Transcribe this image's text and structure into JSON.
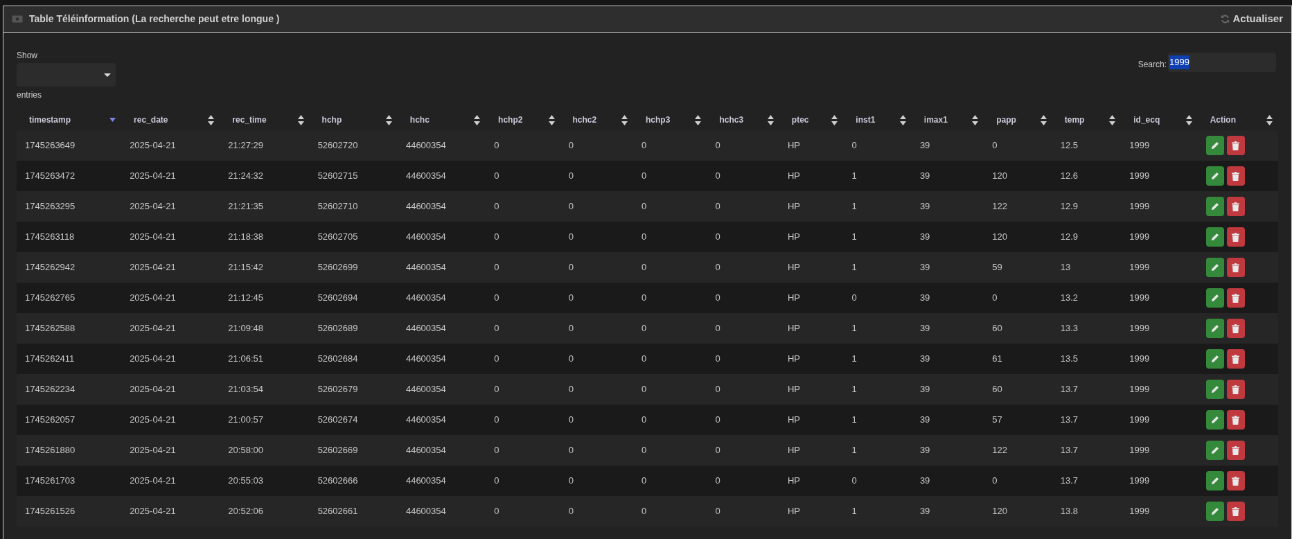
{
  "panel": {
    "title": "Table Téléinformation (La recherche peut etre longue )",
    "refresh_label": "Actualiser"
  },
  "length_control": {
    "label_before": "Show",
    "label_after": "entries"
  },
  "search": {
    "label": "Search:",
    "value": "1999",
    "selected": true
  },
  "table": {
    "columns": [
      {
        "label": "timestamp",
        "sorted": true
      },
      {
        "label": "rec_date",
        "sorted": false
      },
      {
        "label": "rec_time",
        "sorted": false
      },
      {
        "label": "hchp",
        "sorted": false
      },
      {
        "label": "hchc",
        "sorted": false
      },
      {
        "label": "hchp2",
        "sorted": false
      },
      {
        "label": "hchc2",
        "sorted": false
      },
      {
        "label": "hchp3",
        "sorted": false
      },
      {
        "label": "hchc3",
        "sorted": false
      },
      {
        "label": "ptec",
        "sorted": false
      },
      {
        "label": "inst1",
        "sorted": false
      },
      {
        "label": "imax1",
        "sorted": false
      },
      {
        "label": "papp",
        "sorted": false
      },
      {
        "label": "temp",
        "sorted": false
      },
      {
        "label": "id_ecq",
        "sorted": false
      },
      {
        "label": "Action",
        "sorted": false
      }
    ],
    "rows": [
      [
        "1745263649",
        "2025-04-21",
        "21:27:29",
        "52602720",
        "44600354",
        "0",
        "0",
        "0",
        "0",
        "HP",
        "0",
        "39",
        "0",
        "12.5",
        "1999"
      ],
      [
        "1745263472",
        "2025-04-21",
        "21:24:32",
        "52602715",
        "44600354",
        "0",
        "0",
        "0",
        "0",
        "HP",
        "1",
        "39",
        "120",
        "12.6",
        "1999"
      ],
      [
        "1745263295",
        "2025-04-21",
        "21:21:35",
        "52602710",
        "44600354",
        "0",
        "0",
        "0",
        "0",
        "HP",
        "1",
        "39",
        "122",
        "12.9",
        "1999"
      ],
      [
        "1745263118",
        "2025-04-21",
        "21:18:38",
        "52602705",
        "44600354",
        "0",
        "0",
        "0",
        "0",
        "HP",
        "1",
        "39",
        "120",
        "12.9",
        "1999"
      ],
      [
        "1745262942",
        "2025-04-21",
        "21:15:42",
        "52602699",
        "44600354",
        "0",
        "0",
        "0",
        "0",
        "HP",
        "1",
        "39",
        "59",
        "13",
        "1999"
      ],
      [
        "1745262765",
        "2025-04-21",
        "21:12:45",
        "52602694",
        "44600354",
        "0",
        "0",
        "0",
        "0",
        "HP",
        "0",
        "39",
        "0",
        "13.2",
        "1999"
      ],
      [
        "1745262588",
        "2025-04-21",
        "21:09:48",
        "52602689",
        "44600354",
        "0",
        "0",
        "0",
        "0",
        "HP",
        "1",
        "39",
        "60",
        "13.3",
        "1999"
      ],
      [
        "1745262411",
        "2025-04-21",
        "21:06:51",
        "52602684",
        "44600354",
        "0",
        "0",
        "0",
        "0",
        "HP",
        "1",
        "39",
        "61",
        "13.5",
        "1999"
      ],
      [
        "1745262234",
        "2025-04-21",
        "21:03:54",
        "52602679",
        "44600354",
        "0",
        "0",
        "0",
        "0",
        "HP",
        "1",
        "39",
        "60",
        "13.7",
        "1999"
      ],
      [
        "1745262057",
        "2025-04-21",
        "21:00:57",
        "52602674",
        "44600354",
        "0",
        "0",
        "0",
        "0",
        "HP",
        "1",
        "39",
        "57",
        "13.7",
        "1999"
      ],
      [
        "1745261880",
        "2025-04-21",
        "20:58:00",
        "52602669",
        "44600354",
        "0",
        "0",
        "0",
        "0",
        "HP",
        "1",
        "39",
        "122",
        "13.7",
        "1999"
      ],
      [
        "1745261703",
        "2025-04-21",
        "20:55:03",
        "52602666",
        "44600354",
        "0",
        "0",
        "0",
        "0",
        "HP",
        "0",
        "39",
        "0",
        "13.7",
        "1999"
      ],
      [
        "1745261526",
        "2025-04-21",
        "20:52:06",
        "52602661",
        "44600354",
        "0",
        "0",
        "0",
        "0",
        "HP",
        "1",
        "39",
        "120",
        "13.8",
        "1999"
      ]
    ]
  }
}
